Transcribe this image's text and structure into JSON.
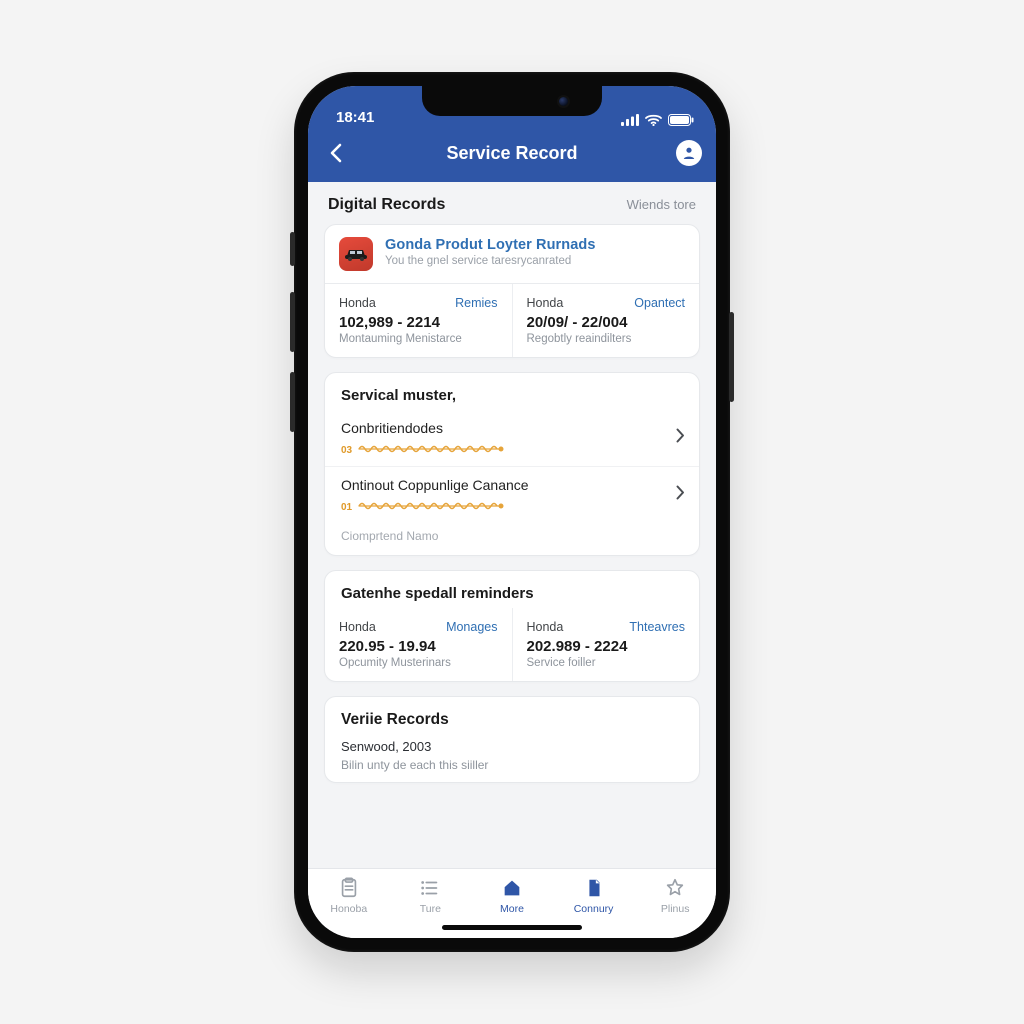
{
  "status": {
    "time": "18:41"
  },
  "nav": {
    "title": "Service Record"
  },
  "digital": {
    "heading": "Digital Records",
    "view_more": "Wiends tore",
    "promo_title": "Gonda Produt Loyter Rurnads",
    "promo_sub": "You the gnel service taresrycanrated",
    "cells": [
      {
        "label": "Honda",
        "action": "Remies",
        "value": "102,989 - 2214",
        "sub": "Montauming Menistarce"
      },
      {
        "label": "Honda",
        "action": "Opantect",
        "value": "20/09/ - 22/004",
        "sub": "Regobtly reaindilters"
      }
    ]
  },
  "muster": {
    "heading": "Servical muster,",
    "rows": [
      {
        "label": "Conbritiendodes",
        "code": "03"
      },
      {
        "label": "Ontinout Coppunlige Canance",
        "code": "01"
      }
    ],
    "footer": "Ciomprtend Namo"
  },
  "reminders": {
    "heading": "Gatenhe spedall reminders",
    "cells": [
      {
        "label": "Honda",
        "action": "Monages",
        "value": "220.95 - 19.94",
        "sub": "Opcumity Musterinars"
      },
      {
        "label": "Honda",
        "action": "Thteavres",
        "value": "202.989 - 2224",
        "sub": "Service foiller"
      }
    ]
  },
  "verie": {
    "heading": "Veriie Records",
    "line1": "Senwood, 2003",
    "line2": "Bilin unty de each this siiller"
  },
  "tabs": [
    {
      "label": "Honoba"
    },
    {
      "label": "Ture"
    },
    {
      "label": "More"
    },
    {
      "label": "Connury"
    },
    {
      "label": "Plinus"
    }
  ]
}
